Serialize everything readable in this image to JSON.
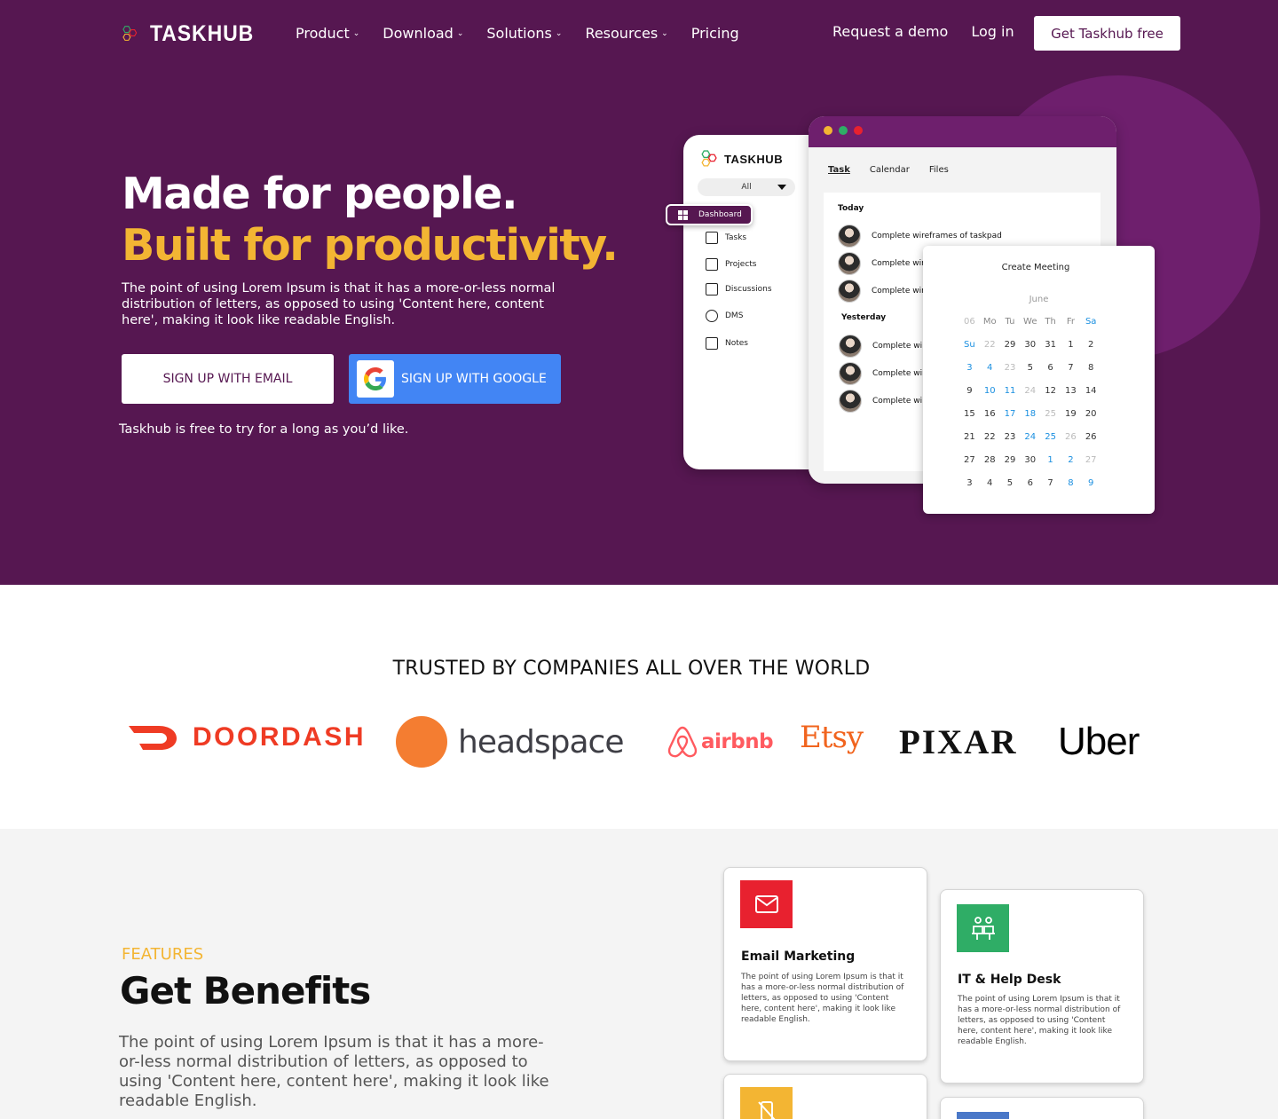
{
  "brand": {
    "name": "TASKHUB"
  },
  "nav": {
    "menu": [
      {
        "label": "Product",
        "has_dropdown": true
      },
      {
        "label": "Download",
        "has_dropdown": true
      },
      {
        "label": "Solutions",
        "has_dropdown": true
      },
      {
        "label": "Resources",
        "has_dropdown": true
      },
      {
        "label": "Pricing",
        "has_dropdown": false
      }
    ],
    "request_demo": "Request a demo",
    "login": "Log in",
    "cta": "Get Taskhub free"
  },
  "hero": {
    "headline_1": "Made for people.",
    "headline_2": "Built for productivity.",
    "paragraph": "The point of using Lorem Ipsum is that it has a more-or-less normal distribution of letters, as opposed to using 'Content here, content here', making it look like readable English.",
    "btn_email": "SIGN UP WITH EMAIL",
    "btn_google": "SIGN UP WITH GOOGLE",
    "note": "Taskhub is free to try for a long as you’d like."
  },
  "mockup": {
    "logo": "TASKHUB",
    "filter": "All",
    "dashboard": "Dashboard",
    "sidebar": [
      "Tasks",
      "Projects",
      "Discussions",
      "DMS",
      "Notes"
    ],
    "tabs": [
      "Task",
      "Calendar",
      "Files"
    ],
    "today": "Today",
    "yesterday": "Yesterday",
    "tasks_today": [
      "Complete wireframes of taskpad",
      "Complete wir",
      "Complete wir"
    ],
    "tasks_yesterday": [
      "Complete wi",
      "Complete wir",
      "Complete wi"
    ],
    "calendar": {
      "title": "Create Meeting",
      "month": "June",
      "headers": [
        "",
        "Mo",
        "Tu",
        "We",
        "Th",
        "Fr",
        "Sa",
        "Su"
      ],
      "rows": [
        [
          "22",
          "29",
          "30",
          "31",
          "1",
          "2",
          "3",
          "4"
        ],
        [
          "23",
          "5",
          "6",
          "7",
          "8",
          "9",
          "10",
          "11"
        ],
        [
          "24",
          "12",
          "13",
          "14",
          "15",
          "16",
          "17",
          "18"
        ],
        [
          "25",
          "19",
          "20",
          "21",
          "22",
          "23",
          "24",
          "25"
        ],
        [
          "26",
          "26",
          "27",
          "28",
          "29",
          "30",
          "1",
          "2"
        ],
        [
          "27",
          "3",
          "4",
          "5",
          "6",
          "7",
          "8",
          "9"
        ]
      ],
      "week_header": "06"
    }
  },
  "trusted": {
    "title": "TRUSTED BY COMPANIES ALL OVER THE WORLD",
    "logos": [
      "DOORDASH",
      "headspace",
      "airbnb",
      "Etsy",
      "PIXAR",
      "Uber"
    ]
  },
  "features": {
    "label": "FEATURES",
    "title": "Get Benefits",
    "paragraph": "The point of using Lorem Ipsum is that it has a more-or-less normal distribution of letters, as opposed to using 'Content here, content here', making it look like readable English.",
    "cards": [
      {
        "title": "Email Marketing",
        "text": "The point of using Lorem Ipsum is that it has a more-or-less normal distribution of letters, as opposed to using 'Content here, content here', making it look like readable English.",
        "color": "#e8212f",
        "icon": "mail-icon"
      },
      {
        "title": "IT & Help Desk",
        "text": "The point of using Lorem Ipsum is that it has a more-or-less normal distribution of letters, as opposed to using 'Content here, content here', making it look like readable English.",
        "color": "#2fad66",
        "icon": "helpdesk-icon"
      }
    ]
  },
  "colors": {
    "hero_bg": "#561751",
    "accent": "#f3b533",
    "google_blue": "#4285f4"
  }
}
